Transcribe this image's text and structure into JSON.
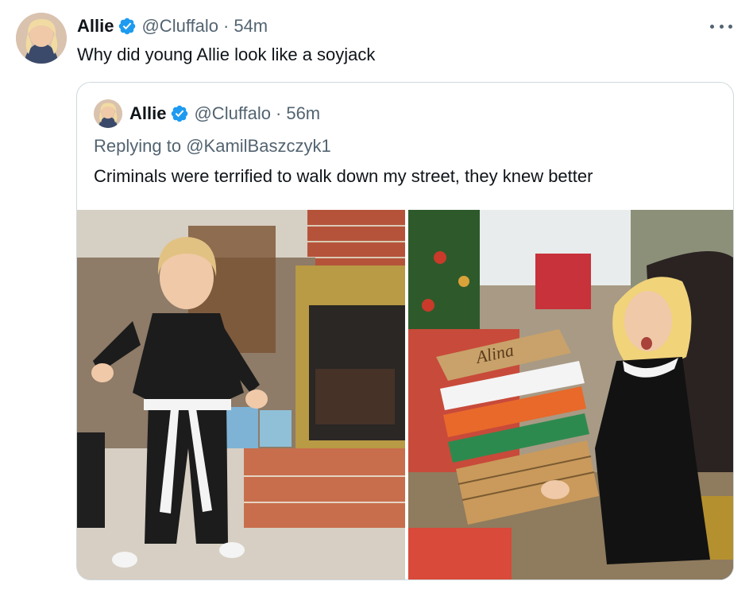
{
  "tweet": {
    "display_name": "Allie",
    "handle": "@Cluffalo",
    "separator": "·",
    "time": "54m",
    "text": "Why did young Allie look like a soyjack",
    "verified_color": "#1d9bf0"
  },
  "quoted": {
    "display_name": "Allie",
    "handle": "@Cluffalo",
    "separator": "·",
    "time": "56m",
    "replying_prefix": "Replying to",
    "replying_to": "@KamilBaszczyk1",
    "text": "Criminals were terrified to walk down my street, they knew better",
    "photos": [
      {
        "name": "karate-photo",
        "signature": "Alina"
      },
      {
        "name": "christmas-photo"
      }
    ]
  }
}
